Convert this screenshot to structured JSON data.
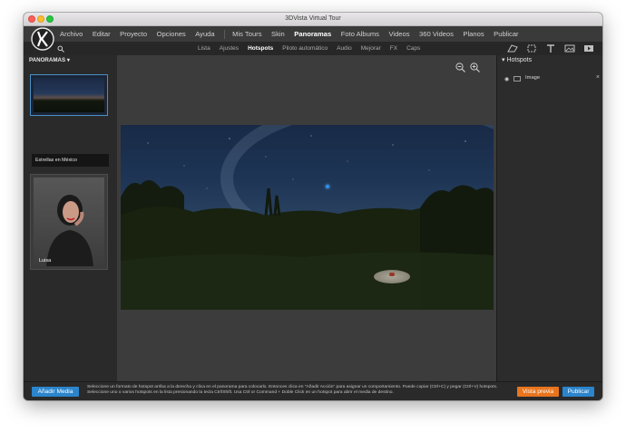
{
  "window": {
    "title": "3DVista Virtual Tour"
  },
  "menu": [
    {
      "label": "Archivo",
      "active": false
    },
    {
      "label": "Editar",
      "active": false
    },
    {
      "label": "Proyecto",
      "active": false
    },
    {
      "label": "Opciones",
      "active": false
    },
    {
      "label": "Ayuda",
      "active": false
    },
    {
      "label": "Mis Tours",
      "active": false
    },
    {
      "label": "Skin",
      "active": false
    },
    {
      "label": "Panoramas",
      "active": true
    },
    {
      "label": "Foto Albums",
      "active": false
    },
    {
      "label": "Videos",
      "active": false
    },
    {
      "label": "360 Videos",
      "active": false
    },
    {
      "label": "Planos",
      "active": false
    },
    {
      "label": "Publicar",
      "active": false
    }
  ],
  "subtabs": [
    {
      "label": "Lista",
      "active": false
    },
    {
      "label": "Ajustes",
      "active": false
    },
    {
      "label": "Hotspots",
      "active": true
    },
    {
      "label": "Piloto automático",
      "active": false
    },
    {
      "label": "Audio",
      "active": false
    },
    {
      "label": "Mejorar",
      "active": false
    },
    {
      "label": "FX",
      "active": false
    },
    {
      "label": "Caps",
      "active": false
    }
  ],
  "left_panel": {
    "header": "PANORAMAS",
    "items": [
      {
        "label": "Estrellas en México",
        "selected": true
      },
      {
        "label": "Luisa",
        "selected": false
      }
    ]
  },
  "right_panel": {
    "header": "Hotspots",
    "items": [
      {
        "label": "Image",
        "icon": "image-icon"
      }
    ]
  },
  "bottom": {
    "add_media": "Añadir Media",
    "hint": "Seleccione un formato de hotspot arriba a la derecha y clica en el panorama para colocarlo. Entonces clica en \"Añadir Acción\" para asignar un comportamiento. Puede copiar (Ctrl+C) y pegar (Ctrl+V) hotspots. Seleccione uno o varios hotspots en la lista presionando la tecla Ctrl/Shift. Usa Ctrl or Command + Doble Click en un hotspot para abrir el media de destino.",
    "preview": "Vista previa",
    "publish": "Publicar"
  },
  "colors": {
    "accent": "#2b85cc",
    "preview": "#e8751e"
  }
}
